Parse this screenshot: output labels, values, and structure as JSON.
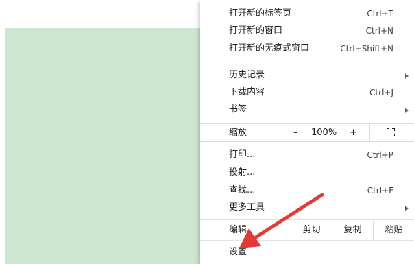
{
  "menu": {
    "group1": [
      {
        "label": "打开新的标签页",
        "shortcut": "Ctrl+T"
      },
      {
        "label": "打开新的窗口",
        "shortcut": "Ctrl+N"
      },
      {
        "label": "打开新的无痕式窗口",
        "shortcut": "Ctrl+Shift+N"
      }
    ],
    "group2": [
      {
        "label": "历史记录",
        "submenu": true
      },
      {
        "label": "下载内容",
        "shortcut": "Ctrl+J"
      },
      {
        "label": "书签",
        "submenu": true
      }
    ],
    "zoom": {
      "label": "缩放",
      "minus": "–",
      "value": "100%",
      "plus": "+"
    },
    "group3": [
      {
        "label": "打印...",
        "shortcut": "Ctrl+P"
      },
      {
        "label": "投射..."
      },
      {
        "label": "查找...",
        "shortcut": "Ctrl+F"
      },
      {
        "label": "更多工具",
        "submenu": true
      }
    ],
    "edit": {
      "label": "编辑",
      "cut": "剪切",
      "copy": "复制",
      "paste": "粘贴"
    },
    "settings": {
      "label": "设置"
    }
  },
  "colors": {
    "background_panel": "#cce6d0",
    "annotation_arrow": "#e53935"
  }
}
